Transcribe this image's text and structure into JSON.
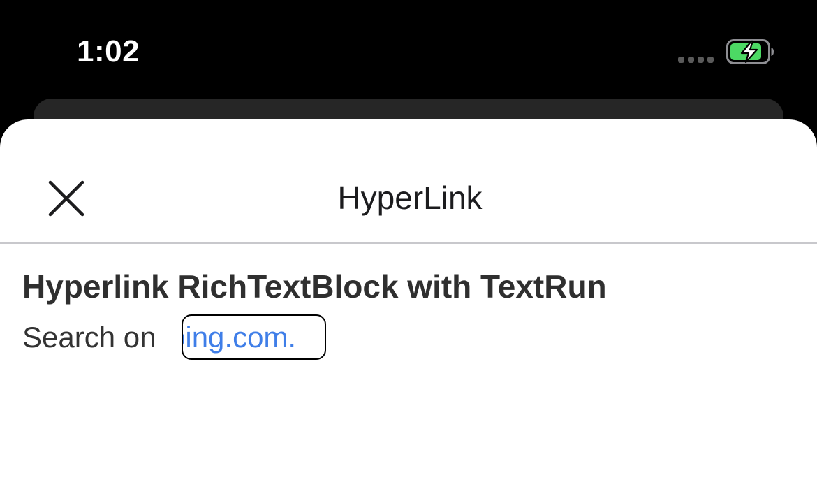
{
  "status_bar": {
    "time": "1:02",
    "signal_icon": "signal-dots-icon",
    "battery_icon": "battery-charging-icon",
    "battery_color": "#4cd964"
  },
  "nav": {
    "title": "HyperLink",
    "close_icon": "close-icon"
  },
  "content": {
    "heading": "Hyperlink RichTextBlock with TextRun",
    "prefix_text": "Search on",
    "link_text": "bing.com.",
    "link_color": "#3f7ee8"
  }
}
